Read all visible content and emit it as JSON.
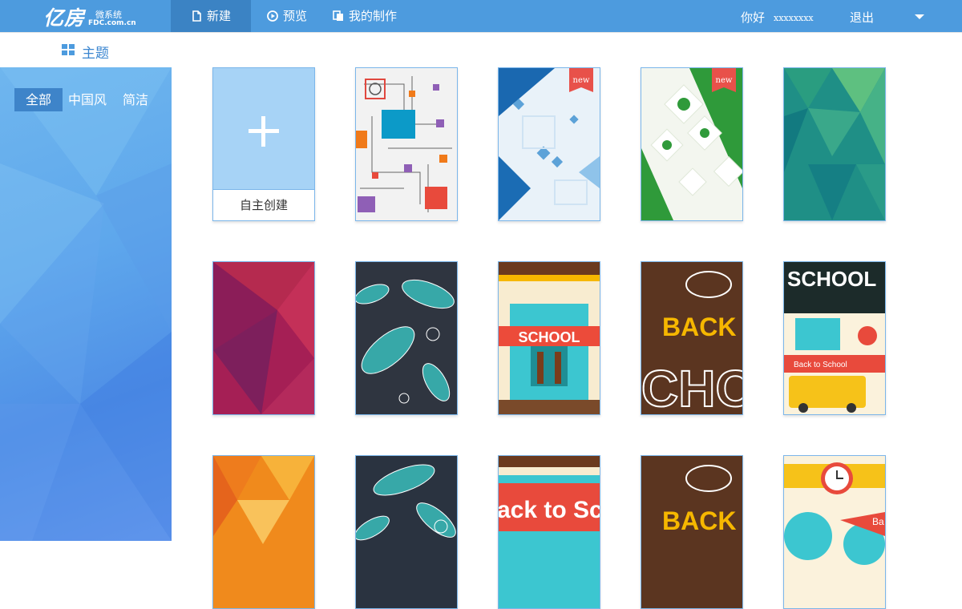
{
  "header": {
    "logo_main": "亿房",
    "logo_sub": "微系统",
    "logo_domain": "FDC.com.cn",
    "nav": [
      {
        "label": "新建",
        "icon": "file-icon"
      },
      {
        "label": "预览",
        "icon": "play-circle-icon"
      },
      {
        "label": "我的制作",
        "icon": "copy-icon"
      }
    ],
    "greeting": "你好",
    "username": "xxxxxxxx",
    "logout": "退出"
  },
  "subheader": {
    "title": "主题",
    "icon": "grid-icon"
  },
  "sidebar": {
    "filters": [
      {
        "label": "全部",
        "active": true
      },
      {
        "label": "中国风",
        "active": false
      },
      {
        "label": "简洁",
        "active": false
      }
    ]
  },
  "grid": {
    "create_label": "自主创建",
    "templates": [
      {
        "name": "circuit-colorful",
        "badge": ""
      },
      {
        "name": "blue-tech",
        "badge": "new"
      },
      {
        "name": "green-eco",
        "badge": "new"
      },
      {
        "name": "teal-triangles",
        "badge": ""
      },
      {
        "name": "magenta-triangles",
        "badge": ""
      },
      {
        "name": "paisley-teal",
        "badge": ""
      },
      {
        "name": "school-building",
        "badge": "",
        "text": "SCHOOL"
      },
      {
        "name": "back-to-school-chalk",
        "badge": "",
        "text": "BACK"
      },
      {
        "name": "school-collage",
        "badge": "",
        "text": "SCHOOL",
        "subtext": "Back to School"
      },
      {
        "name": "orange-triangles",
        "badge": ""
      },
      {
        "name": "paisley-dark",
        "badge": ""
      },
      {
        "name": "back-to-school-banner",
        "badge": "",
        "text": "ack to Sch"
      },
      {
        "name": "back-chalk-2",
        "badge": "",
        "text": "BACK"
      },
      {
        "name": "alarm-clock",
        "badge": "",
        "text": "Ba"
      }
    ]
  },
  "colors": {
    "primary": "#4d9bde",
    "nav_active": "#3b83c4",
    "badge": "#e8514a"
  }
}
